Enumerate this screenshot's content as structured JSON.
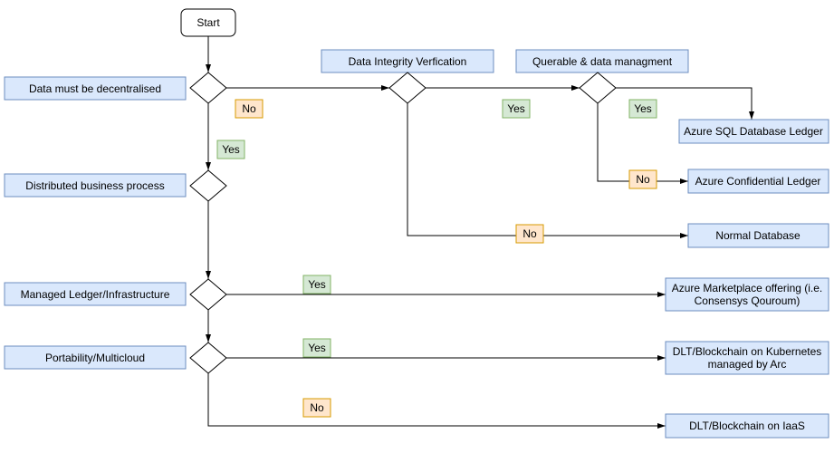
{
  "start": "Start",
  "questions": {
    "decentralised": "Data must be decentralised",
    "integrity": "Data Integrity Verfication",
    "querable": "Querable & data managment",
    "distributed": "Distributed business process",
    "managed": "Managed Ledger/Infrastructure",
    "portability": "Portability/Multicloud"
  },
  "results": {
    "sql_ledger": "Azure SQL Database Ledger",
    "confidential": "Azure Confidential Ledger",
    "normal_db": "Normal Database",
    "marketplace1": "Azure Marketplace offering (i.e.",
    "marketplace2": "Consensys Qouroum)",
    "k8s1": "DLT/Blockchain on Kubernetes",
    "k8s2": "managed by Arc",
    "iaas": "DLT/Blockchain on IaaS"
  },
  "yes": "Yes",
  "no": "No",
  "chart_data": {
    "type": "flowchart",
    "title": "",
    "nodes": [
      {
        "id": "start",
        "type": "terminator",
        "label": "Start"
      },
      {
        "id": "d1",
        "type": "decision",
        "question": "Data must be decentralised"
      },
      {
        "id": "d2",
        "type": "decision",
        "question": "Data Integrity Verfication"
      },
      {
        "id": "d3",
        "type": "decision",
        "question": "Querable & data managment"
      },
      {
        "id": "d4",
        "type": "decision",
        "question": "Distributed business process"
      },
      {
        "id": "d5",
        "type": "decision",
        "question": "Managed Ledger/Infrastructure"
      },
      {
        "id": "d6",
        "type": "decision",
        "question": "Portability/Multicloud"
      },
      {
        "id": "r1",
        "type": "result",
        "label": "Azure SQL Database Ledger"
      },
      {
        "id": "r2",
        "type": "result",
        "label": "Azure Confidential Ledger"
      },
      {
        "id": "r3",
        "type": "result",
        "label": "Normal Database"
      },
      {
        "id": "r4",
        "type": "result",
        "label": "Azure Marketplace offering (i.e. Consensys Qouroum)"
      },
      {
        "id": "r5",
        "type": "result",
        "label": "DLT/Blockchain on Kubernetes managed by Arc"
      },
      {
        "id": "r6",
        "type": "result",
        "label": "DLT/Blockchain on IaaS"
      }
    ],
    "edges": [
      {
        "from": "start",
        "to": "d1",
        "label": ""
      },
      {
        "from": "d1",
        "to": "d2",
        "label": "No"
      },
      {
        "from": "d1",
        "to": "d4",
        "label": "Yes"
      },
      {
        "from": "d2",
        "to": "d3",
        "label": "Yes"
      },
      {
        "from": "d2",
        "to": "r3",
        "label": "No"
      },
      {
        "from": "d3",
        "to": "r1",
        "label": "Yes"
      },
      {
        "from": "d3",
        "to": "r2",
        "label": "No"
      },
      {
        "from": "d4",
        "to": "d5",
        "label": ""
      },
      {
        "from": "d5",
        "to": "r4",
        "label": "Yes"
      },
      {
        "from": "d5",
        "to": "d6",
        "label": ""
      },
      {
        "from": "d6",
        "to": "r5",
        "label": "Yes"
      },
      {
        "from": "d6",
        "to": "r6",
        "label": "No"
      }
    ]
  }
}
